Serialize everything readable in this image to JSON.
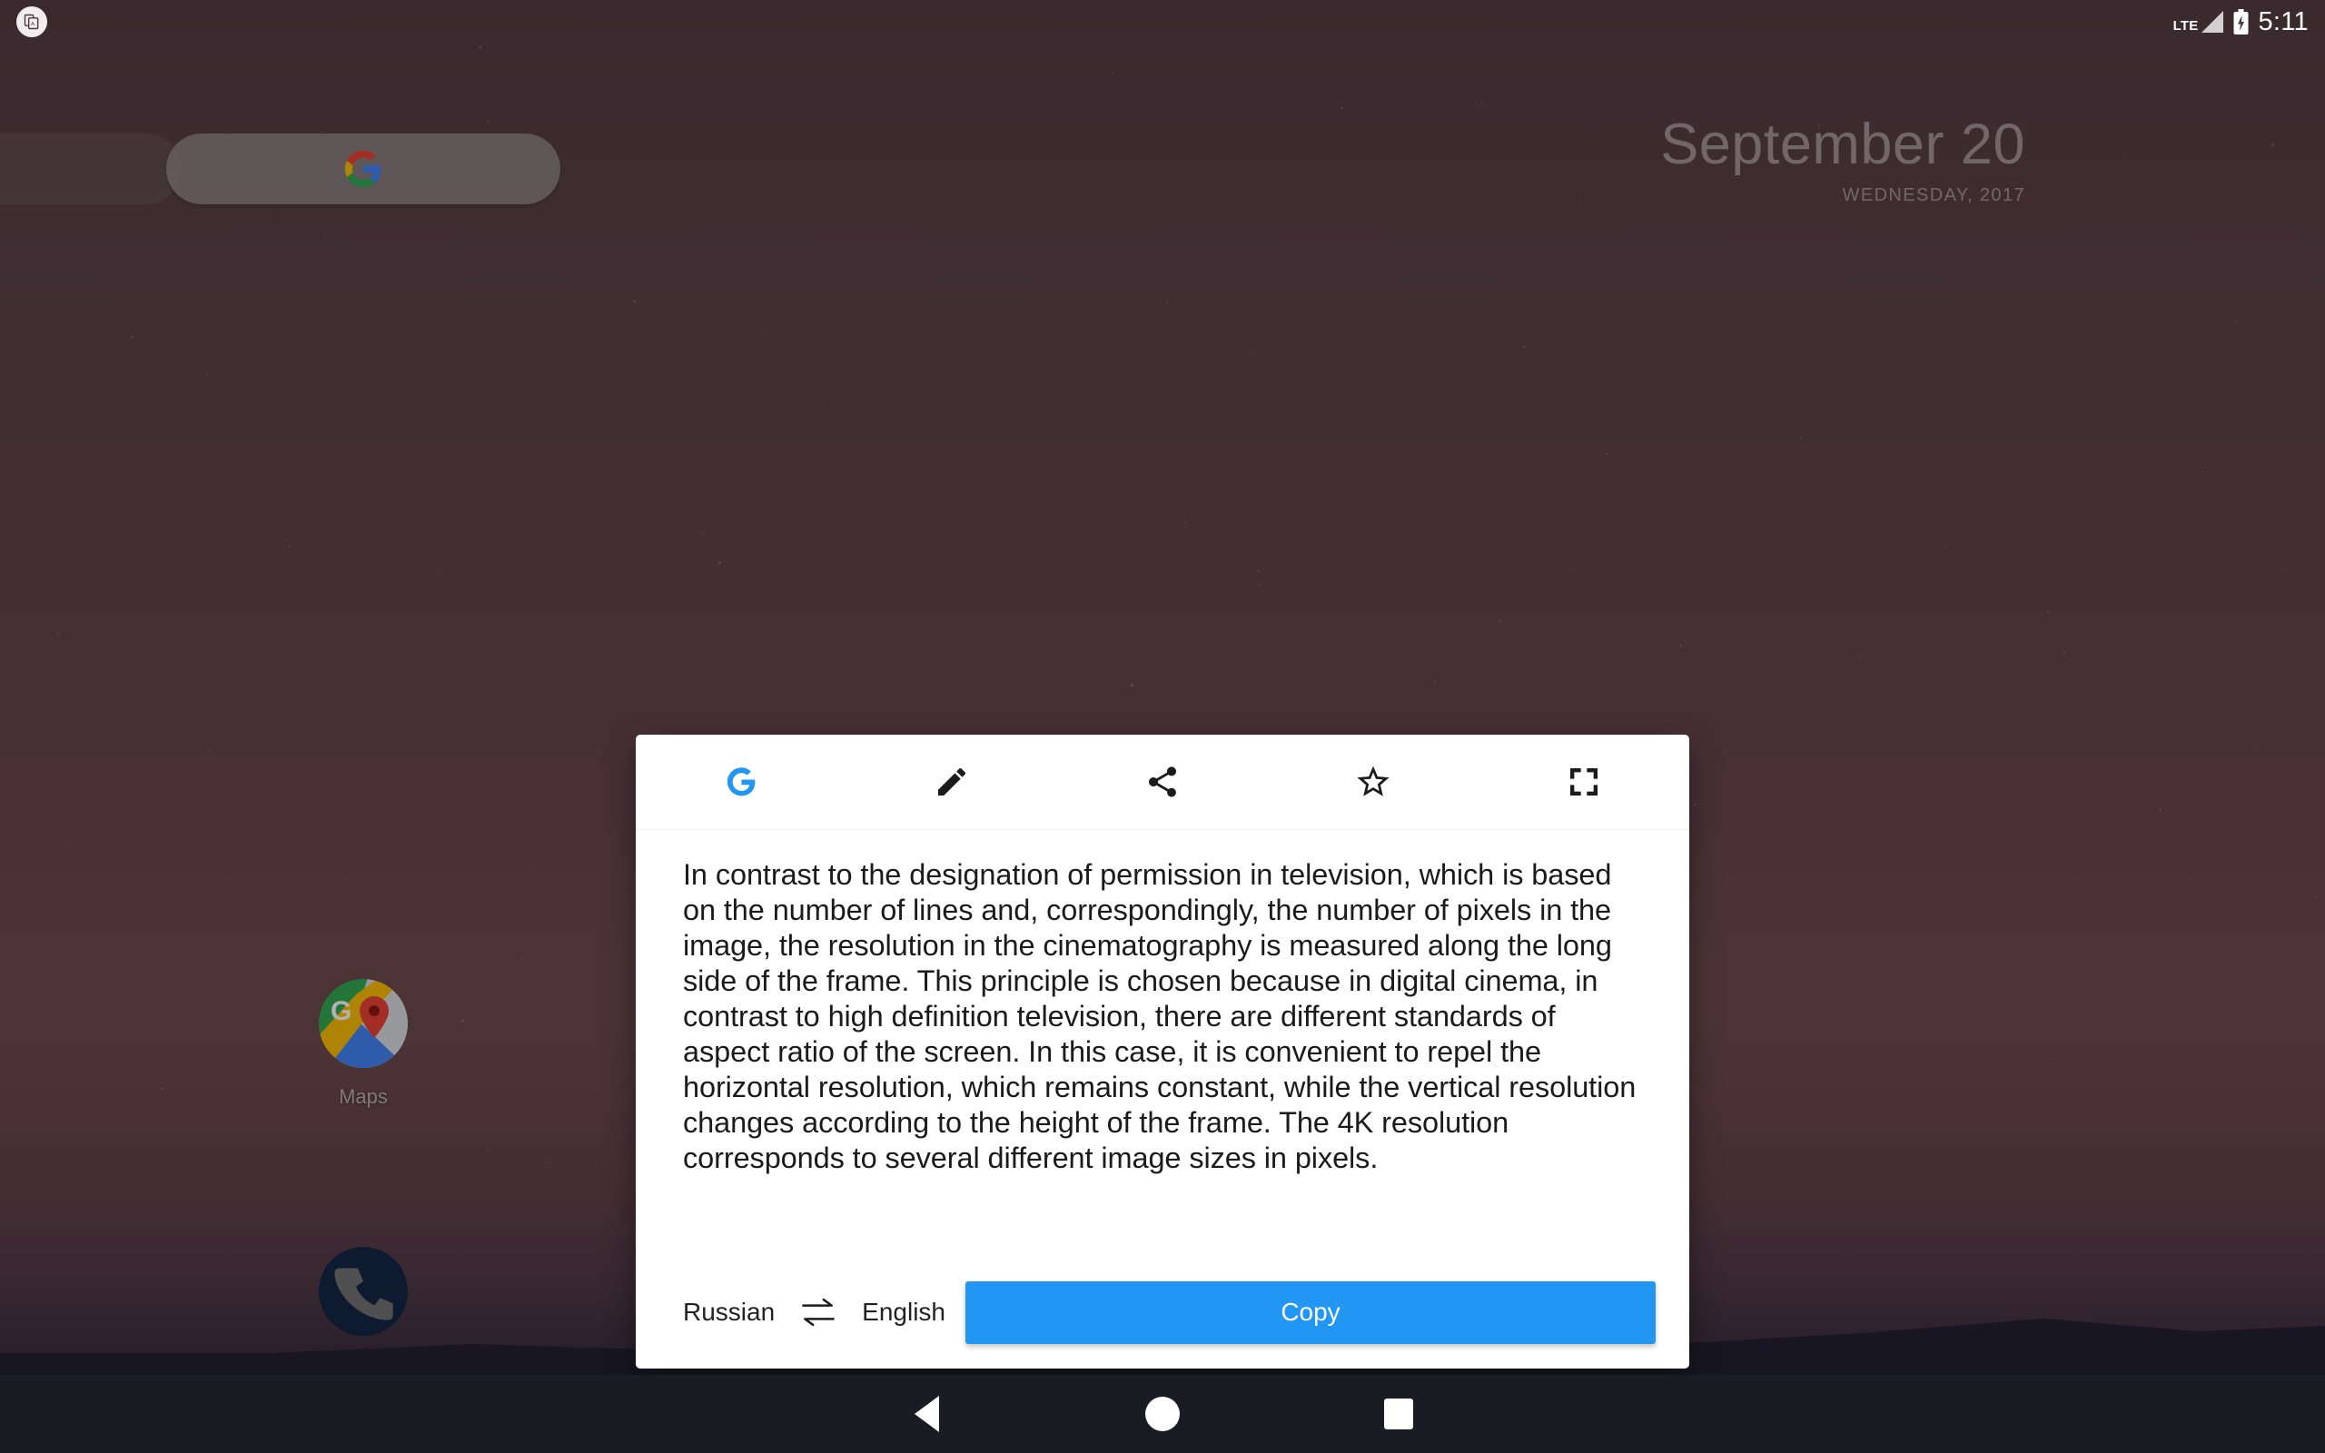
{
  "status_bar": {
    "notification_icon": "translate-copy-icon",
    "network_label": "LTE",
    "signal_icon": "signal-bars-icon",
    "battery_icon": "battery-charging-icon",
    "clock": "5:11"
  },
  "home_screen": {
    "search_widget": {
      "icon": "google-g-icon",
      "name": "google-search-bar"
    },
    "date_widget": {
      "date": "September 20",
      "day_year": "WEDNESDAY, 2017"
    },
    "apps": [
      {
        "label": "Maps",
        "icon": "google-maps-icon"
      },
      {
        "label": "",
        "icon": "phone-dialer-icon"
      }
    ]
  },
  "translate_card": {
    "toolbar": [
      {
        "name": "google-g-icon",
        "label": "Google"
      },
      {
        "name": "pencil-edit-icon",
        "label": "Edit"
      },
      {
        "name": "share-icon",
        "label": "Share"
      },
      {
        "name": "star-outline-icon",
        "label": "Star"
      },
      {
        "name": "fullscreen-icon",
        "label": "Fullscreen"
      }
    ],
    "translated_text": "In contrast to the designation of permission in television, which is based on the number of lines and, correspondingly, the number of pixels in the image, the resolution in the cinematography is measured along the long side of the frame. This principle is chosen because in digital cinema, in contrast to high definition television, there are different standards of aspect ratio of the screen. In this case, it is convenient to repel the horizontal resolution, which remains constant, while the vertical resolution changes according to the height of the frame. The 4K resolution corresponds to several different image sizes in pixels.",
    "source_language": "Russian",
    "target_language": "English",
    "swap_icon": "swap-arrows-icon",
    "copy_label": "Copy",
    "accent_color": "#2196f3"
  },
  "nav_bar": {
    "back": "back-triangle-icon",
    "home": "home-circle-icon",
    "recents": "recents-square-icon"
  }
}
